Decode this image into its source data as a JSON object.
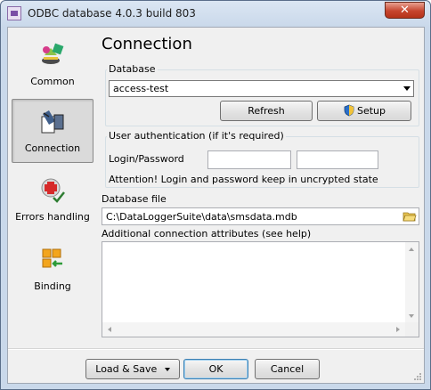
{
  "window": {
    "title": "ODBC database 4.0.3 build 803",
    "close_label": "✕"
  },
  "sidebar": {
    "items": [
      {
        "label": "Common",
        "icon": "common-icon",
        "active": false
      },
      {
        "label": "Connection",
        "icon": "connection-icon",
        "active": true
      },
      {
        "label": "Errors handling",
        "icon": "errors-icon",
        "active": false
      },
      {
        "label": "Binding",
        "icon": "binding-icon",
        "active": false
      }
    ]
  },
  "main": {
    "title": "Connection",
    "database": {
      "label": "Database",
      "selected": "access-test",
      "refresh_label": "Refresh",
      "setup_label": "Setup"
    },
    "auth": {
      "label": "User authentication (if it's required)",
      "login_label": "Login/Password",
      "login_value": "",
      "password_value": "",
      "note": "Attention! Login and password keep in uncrypted state"
    },
    "database_file": {
      "label": "Database file",
      "value": "C:\\DataLoggerSuite\\data\\smsdata.mdb"
    },
    "attributes": {
      "label": "Additional connection attributes (see help)",
      "value": ""
    }
  },
  "footer": {
    "load_save_label": "Load & Save",
    "ok_label": "OK",
    "cancel_label": "Cancel"
  },
  "colors": {
    "accent": "#3c7fb1",
    "close": "#c6452e"
  }
}
